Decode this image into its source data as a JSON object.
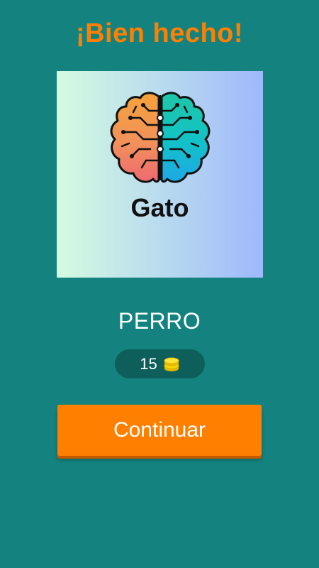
{
  "header": {
    "title": "¡Bien hecho!"
  },
  "card": {
    "icon": "brain-icon",
    "word": "Gato"
  },
  "answer": {
    "text": "PERRO"
  },
  "coins": {
    "value": "15",
    "icon": "coins-icon"
  },
  "actions": {
    "continue_label": "Continuar"
  },
  "colors": {
    "background": "#14837f",
    "accent": "#ff8000",
    "pill": "#0e5f5b",
    "coin": "#ffd700"
  }
}
